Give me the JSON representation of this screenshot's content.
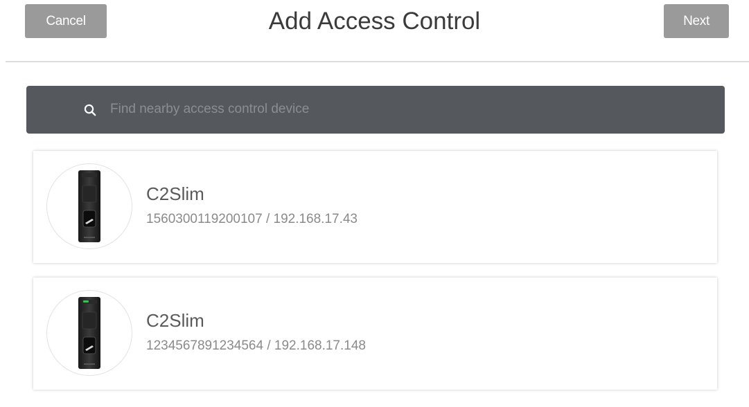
{
  "header": {
    "cancel_label": "Cancel",
    "title": "Add Access Control",
    "next_label": "Next"
  },
  "search": {
    "placeholder": "Find nearby access control device",
    "icon": "search-icon"
  },
  "devices": [
    {
      "name": "C2Slim",
      "info": "1560300119200107 / 192.168.17.43",
      "icon": "access-control-device-icon"
    },
    {
      "name": "C2Slim",
      "info": "1234567891234564 / 192.168.17.148",
      "icon": "access-control-device-icon"
    }
  ],
  "colors": {
    "button_bg": "#9a9a9a",
    "search_bg": "#55585d",
    "title_text": "#3b3b3b"
  }
}
